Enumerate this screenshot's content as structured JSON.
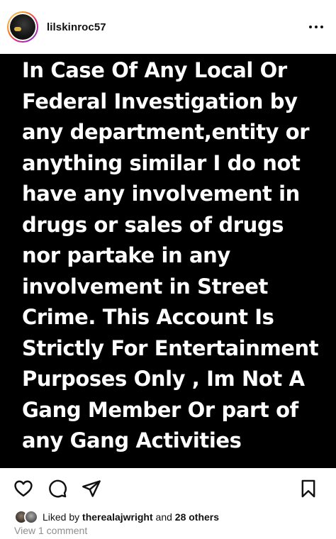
{
  "post": {
    "username": "lilskinroc57",
    "image_text": "In Case Of Any Local Or Federal Investigation by any department,entity or anything similar I do not have any involvement in drugs or sales of drugs nor partake in any involvement in Street Crime. This Account Is Strictly For Entertainment Purposes Only , Im Not A Gang Member Or part of any Gang Activities"
  },
  "icons": {
    "more": "more-dots-icon",
    "like": "heart-icon",
    "comment": "comment-bubble-icon",
    "share": "send-icon",
    "save": "bookmark-icon"
  },
  "likes": {
    "prefix": "Liked by",
    "user": "therealajwright",
    "joiner": "and",
    "others": "28 others"
  },
  "comments": {
    "view_label": "View 1 comment"
  },
  "colors": {
    "post_background": "#000000",
    "post_text": "#ffffff",
    "muted_text": "#8e8e8e"
  }
}
